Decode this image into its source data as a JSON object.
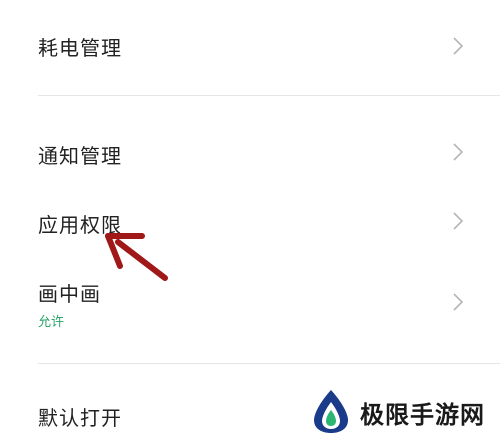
{
  "settings": {
    "items": [
      {
        "label": "耗电管理",
        "chevron_icon": "chevron-right-icon"
      },
      {
        "label": "通知管理",
        "chevron_icon": "chevron-right-icon"
      },
      {
        "label": "应用权限",
        "chevron_icon": "chevron-right-icon"
      },
      {
        "label": "画中画",
        "sublabel": "允许",
        "chevron_icon": "chevron-right-icon"
      },
      {
        "label": "默认打开"
      }
    ]
  },
  "annotation": {
    "arrow_color": "#a01818",
    "arrow_icon": "annotation-arrow-icon"
  },
  "watermark": {
    "text": "极限手游网",
    "logo_icon": "site-logo-icon",
    "logo_colors": [
      "#1a3a8a",
      "#2bb673"
    ]
  },
  "colors": {
    "accent_green": "#2aa36b",
    "text": "#222222",
    "chevron": "#b5b5b5"
  }
}
